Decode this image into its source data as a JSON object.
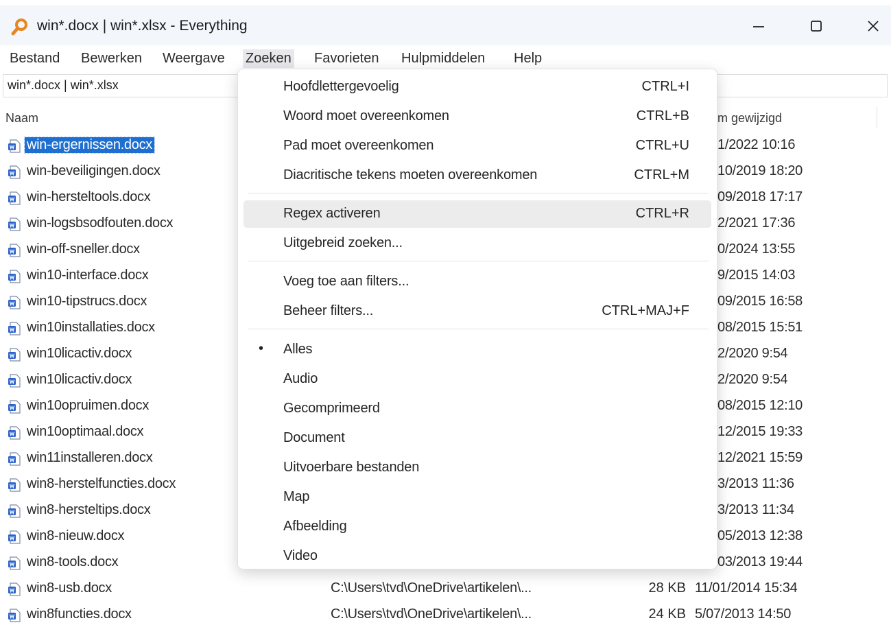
{
  "window": {
    "title": "win*.docx | win*.xlsx - Everything"
  },
  "menubar": [
    {
      "label": "Bestand"
    },
    {
      "label": "Bewerken"
    },
    {
      "label": "Weergave"
    },
    {
      "label": "Zoeken"
    },
    {
      "label": "Favorieten"
    },
    {
      "label": "Hulpmiddelen"
    },
    {
      "label": "Help"
    }
  ],
  "search": {
    "value": "win*.docx | win*.xlsx"
  },
  "columns": {
    "name": "Naam",
    "date": "m gewijzigd"
  },
  "files": [
    {
      "name": "win-ergernissen.docx",
      "date": "1/2022 10:16"
    },
    {
      "name": "win-beveiligingen.docx",
      "date": "10/2019 18:20"
    },
    {
      "name": "win-hersteltools.docx",
      "date": "09/2018 17:17"
    },
    {
      "name": "win-logsbsodfouten.docx",
      "date": "2/2021 17:36"
    },
    {
      "name": "win-off-sneller.docx",
      "date": "0/2024 13:55"
    },
    {
      "name": "win10-interface.docx",
      "date": "9/2015 14:03"
    },
    {
      "name": "win10-tipstrucs.docx",
      "date": "09/2015 16:58"
    },
    {
      "name": "win10installaties.docx",
      "date": "08/2015 15:51"
    },
    {
      "name": "win10licactiv.docx",
      "date": "2/2020 9:54"
    },
    {
      "name": "win10licactiv.docx",
      "date": "2/2020 9:54"
    },
    {
      "name": "win10opruimen.docx",
      "date": "08/2015 12:10"
    },
    {
      "name": "win10optimaal.docx",
      "date": "12/2015 19:33"
    },
    {
      "name": "win11installeren.docx",
      "date": "12/2021 15:59"
    },
    {
      "name": "win8-herstelfuncties.docx",
      "date": "3/2013 11:36"
    },
    {
      "name": "win8-hersteltips.docx",
      "date": "3/2013 11:34"
    },
    {
      "name": "win8-nieuw.docx",
      "date": "05/2013 12:38"
    },
    {
      "name": "win8-tools.docx",
      "date": "03/2013 19:44"
    },
    {
      "name": "win8-usb.docx",
      "path": "C:\\Users\\tvd\\OneDrive\\artikelen\\...",
      "size": "28 KB",
      "date": "11/01/2014 15:34"
    },
    {
      "name": "win8functies.docx",
      "path": "C:\\Users\\tvd\\OneDrive\\artikelen\\...",
      "size": "24 KB",
      "date": "5/07/2013 14:50"
    }
  ],
  "zoeken_menu": {
    "group1": [
      {
        "label": "Hoofdlettergevoelig",
        "shortcut": "CTRL+I"
      },
      {
        "label": "Woord moet overeenkomen",
        "shortcut": "CTRL+B"
      },
      {
        "label": "Pad moet overeenkomen",
        "shortcut": "CTRL+U"
      },
      {
        "label": "Diacritische tekens moeten overeenkomen",
        "shortcut": "CTRL+M"
      }
    ],
    "group2": [
      {
        "label": "Regex activeren",
        "shortcut": "CTRL+R"
      },
      {
        "label": "Uitgebreid zoeken..."
      }
    ],
    "group3": [
      {
        "label": "Voeg toe aan filters..."
      },
      {
        "label": "Beheer filters...",
        "shortcut": "CTRL+MAJ+F"
      }
    ],
    "group4": [
      {
        "label": "Alles",
        "bullet": "•"
      },
      {
        "label": "Audio"
      },
      {
        "label": "Gecomprimeerd"
      },
      {
        "label": "Document"
      },
      {
        "label": "Uitvoerbare bestanden"
      },
      {
        "label": "Map"
      },
      {
        "label": "Afbeelding"
      },
      {
        "label": "Video"
      }
    ]
  },
  "colors": {
    "selection": "#1e6fd0",
    "titlebar": "#f3f6fb",
    "app_icon": "#e8871e",
    "doc_icon": "#2b63c9"
  }
}
